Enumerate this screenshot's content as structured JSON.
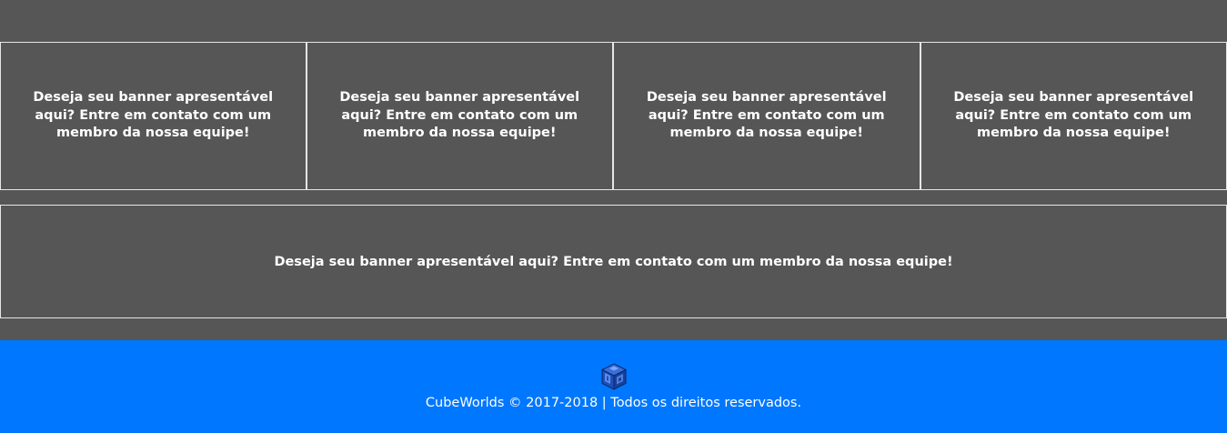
{
  "banners": {
    "row": [
      {
        "text": "Deseja seu banner apresentável aqui? Entre em contato com um membro da nossa equipe!"
      },
      {
        "text": "Deseja seu banner apresentável aqui? Entre em contato com um membro da nossa equipe!"
      },
      {
        "text": "Deseja seu banner apresentável aqui? Entre em contato com um membro da nossa equipe!"
      },
      {
        "text": "Deseja seu banner apresentável aqui? Entre em contato com um membro da nossa equipe!"
      }
    ],
    "wide": {
      "text": "Deseja seu banner apresentável aqui? Entre em contato com um membro da nossa equipe!"
    }
  },
  "footer": {
    "logo_icon": "cube-logo-icon",
    "copyright": "CubeWorlds © 2017-2018 | Todos os direitos reservados."
  },
  "colors": {
    "page_background": "#565656",
    "banner_border": "#e6e6e6",
    "footer_background": "#0077ff",
    "text": "#ffffff"
  }
}
